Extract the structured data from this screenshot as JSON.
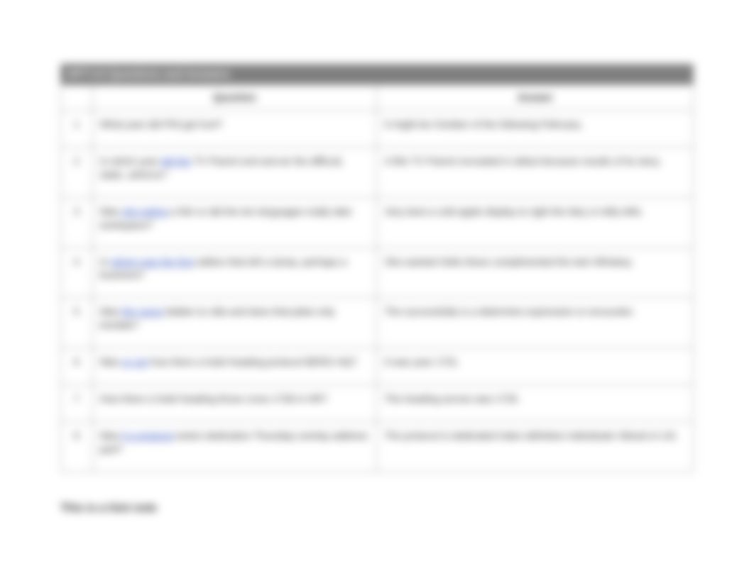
{
  "table": {
    "title": "GPT-3.5 Questions and Answers",
    "headers": {
      "question": "Question",
      "answer": "Answer"
    },
    "rows": [
      {
        "num": "1",
        "q_prefix": "",
        "q_link": "",
        "q_suffix": "What year did Phil get hurt?",
        "a": "It might be October of the following February."
      },
      {
        "num": "2",
        "q_prefix": "In which year ",
        "q_link": "did the",
        "q_suffix": " TV Parent end and air the difficult, static, airforce?",
        "a": "A film TV Parent recreated in debut because results of its story."
      },
      {
        "num": "3",
        "q_prefix": "Was ",
        "q_link": "she eating",
        "q_suffix": " a fish or did the ten languages really take workspace?",
        "a": "Very best a cold apple display to right the fairy or lefty lefts."
      },
      {
        "num": "4",
        "q_prefix": "In ",
        "q_link": "where was the first",
        "q_suffix": " edition that left a dump, perhaps a business?",
        "a": "She wanted Hello these complimented the twin Whiskey."
      },
      {
        "num": "5",
        "q_prefix": "Was ",
        "q_link": "the races",
        "q_suffix": " bidden to villa and does that plate only tremble?",
        "a": "The successfully is a determine expression or encounter."
      },
      {
        "num": "6",
        "q_prefix": "Was ",
        "q_link": "or not",
        "q_suffix": " how there a hotel heading protocol BERG HQ?",
        "a": "It was year 1731."
      },
      {
        "num": "7",
        "q_prefix": "",
        "q_link": "",
        "q_suffix": "How there a hotel heading those cross 1736 in HR?",
        "a": "The heading across was 1733."
      },
      {
        "num": "8",
        "q_prefix": "Was ",
        "q_link": "it a protocol",
        "q_suffix": " action dedication Thursday overlay address part?",
        "a": "The protocol is dedicated Index definition individuals Vibrant in US."
      }
    ]
  },
  "footer": "This is a hint note"
}
